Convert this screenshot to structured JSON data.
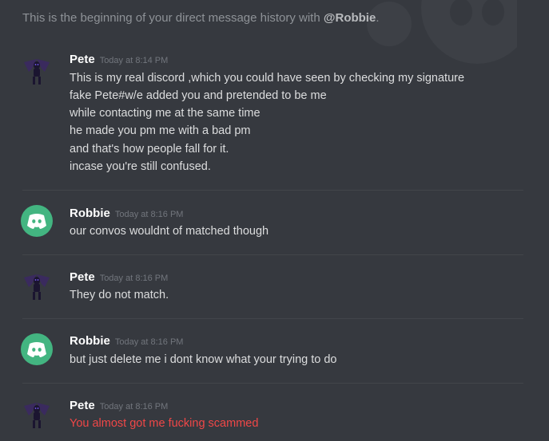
{
  "intro": {
    "prefix": "This is the beginning of your direct message history with ",
    "user": "@Robbie",
    "suffix": "."
  },
  "colors": {
    "background": "#36393f",
    "discord_green": "#43b581",
    "error_red": "#f04747"
  },
  "messages": [
    {
      "author": "Pete",
      "avatar_icon": "winged-demon-avatar-icon",
      "timestamp": "Today at 8:14 PM",
      "lines": [
        "This is my real discord ,which you could have seen by checking my signature",
        "fake Pete#w/e added you and pretended to be me",
        "while contacting me at the same time",
        "he made you pm me with a bad pm",
        "and that's how people fall for it.",
        "incase you're still confused."
      ]
    },
    {
      "author": "Robbie",
      "avatar_icon": "discord-logo-avatar-icon",
      "timestamp": "Today at 8:16 PM",
      "lines": [
        "our convos wouldnt of matched though"
      ]
    },
    {
      "author": "Pete",
      "avatar_icon": "winged-demon-avatar-icon",
      "timestamp": "Today at 8:16 PM",
      "lines": [
        "They do not match."
      ]
    },
    {
      "author": "Robbie",
      "avatar_icon": "discord-logo-avatar-icon",
      "timestamp": "Today at 8:16 PM",
      "lines": [
        "but just delete me i dont know what your trying to do"
      ]
    },
    {
      "author": "Pete",
      "avatar_icon": "winged-demon-avatar-icon",
      "timestamp": "Today at 8:16 PM",
      "lines": [
        "You almost got me fucking scammed"
      ],
      "text_color": "#f04747"
    }
  ]
}
